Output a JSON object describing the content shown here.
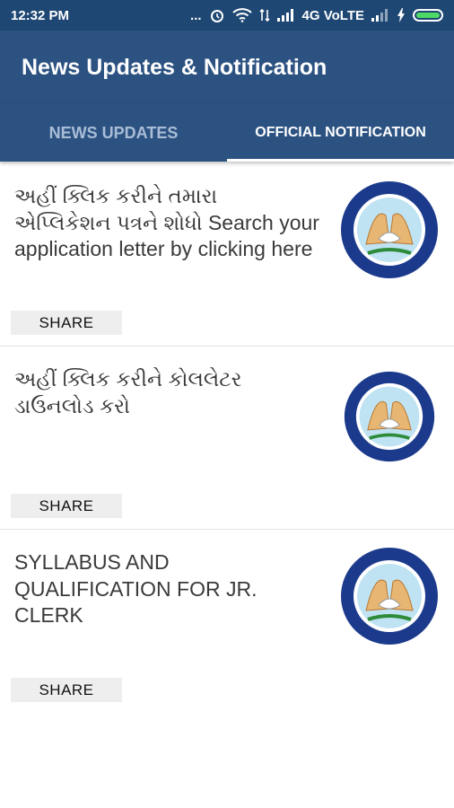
{
  "status_bar": {
    "time": "12:32 PM",
    "dots": "...",
    "network": "4G VoLTE",
    "battery_level": 1.0,
    "battery_color": "#4cd964"
  },
  "app_bar": {
    "title": "News Updates & Notification"
  },
  "tabs": [
    {
      "label": "NEWS UPDATES",
      "active": false
    },
    {
      "label": "OFFICIAL NOTIFICATION",
      "active": true
    }
  ],
  "items": [
    {
      "text": "અહીં ક્લિક કરીને તમારા એપ્લિકેશન પત્રને શોધો Search your application letter by clicking here",
      "share_label": "SHARE",
      "logo": "rajkot-municipal-corporation-logo"
    },
    {
      "text": "અહીં ક્લિક કરીને કોલલેટર ડાઉનલોડ કરો",
      "share_label": "SHARE",
      "logo": "rajkot-municipal-corporation-logo"
    },
    {
      "text": "SYLLABUS AND QUALIFICATION FOR JR. CLERK",
      "share_label": "SHARE",
      "logo": "rajkot-municipal-corporation-logo"
    }
  ],
  "colors": {
    "status_bar": "#1e4773",
    "app_bar": "#2c5282",
    "tab_inactive": "#aabdd6",
    "tab_active": "#ffffff"
  }
}
